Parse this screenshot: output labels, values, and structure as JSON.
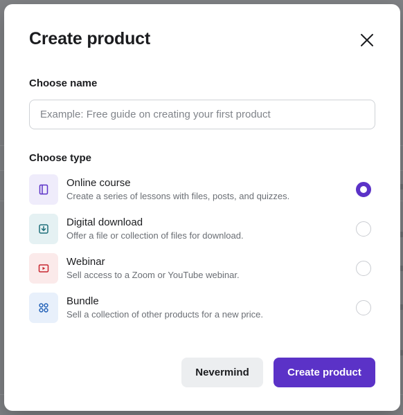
{
  "modal": {
    "title": "Create product",
    "close_icon": "close-icon"
  },
  "name_section": {
    "label": "Choose name",
    "value": "",
    "placeholder": "Example: Free guide on creating your first product"
  },
  "type_section": {
    "label": "Choose type",
    "selected": "Online course",
    "options": [
      {
        "title": "Online course",
        "description": "Create a series of lessons with files, posts, and quizzes.",
        "icon": "sidebar-layout-icon",
        "icon_color": "#5b32c7",
        "icon_bg": "#efecfb",
        "checked": true
      },
      {
        "title": "Digital download",
        "description": "Offer a file or collection of files for download.",
        "icon": "download-icon",
        "icon_color": "#1f6f7a",
        "icon_bg": "#e5f1f3",
        "checked": false
      },
      {
        "title": "Webinar",
        "description": "Sell access to a Zoom or YouTube webinar.",
        "icon": "video-play-icon",
        "icon_color": "#c8262f",
        "icon_bg": "#fbeaea",
        "checked": false
      },
      {
        "title": "Bundle",
        "description": "Sell a collection of other products for a new price.",
        "icon": "grid-icon",
        "icon_color": "#2563b8",
        "icon_bg": "#e8f0fb",
        "checked": false
      }
    ]
  },
  "footer": {
    "cancel_label": "Nevermind",
    "submit_label": "Create product"
  },
  "colors": {
    "accent": "#5b32c7",
    "backdrop": "#808285"
  }
}
